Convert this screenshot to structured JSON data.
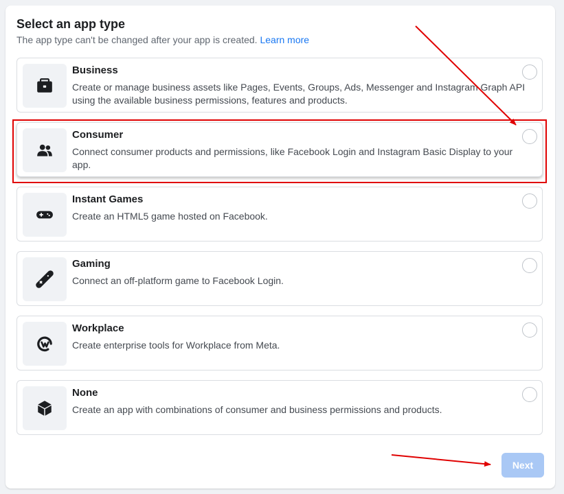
{
  "header": {
    "title": "Select an app type",
    "subtitle": "The app type can't be changed after your app is created.",
    "learn_more": "Learn more"
  },
  "options": [
    {
      "title": "Business",
      "description": "Create or manage business assets like Pages, Events, Groups, Ads, Messenger and Instagram Graph API using the available business permissions, features and products.",
      "icon": "briefcase-icon"
    },
    {
      "title": "Consumer",
      "description": "Connect consumer products and permissions, like Facebook Login and Instagram Basic Display to your app.",
      "icon": "people-icon"
    },
    {
      "title": "Instant Games",
      "description": "Create an HTML5 game hosted on Facebook.",
      "icon": "gamepad-icon"
    },
    {
      "title": "Gaming",
      "description": "Connect an off-platform game to Facebook Login.",
      "icon": "controller-icon"
    },
    {
      "title": "Workplace",
      "description": "Create enterprise tools for Workplace from Meta.",
      "icon": "workplace-logo-icon"
    },
    {
      "title": "None",
      "description": "Create an app with combinations of consumer and business permissions and products.",
      "icon": "cube-icon"
    }
  ],
  "footer": {
    "next_label": "Next"
  },
  "colors": {
    "link": "#1877f2",
    "next_disabled": "#a9c8f5",
    "annotation": "#e00000"
  }
}
